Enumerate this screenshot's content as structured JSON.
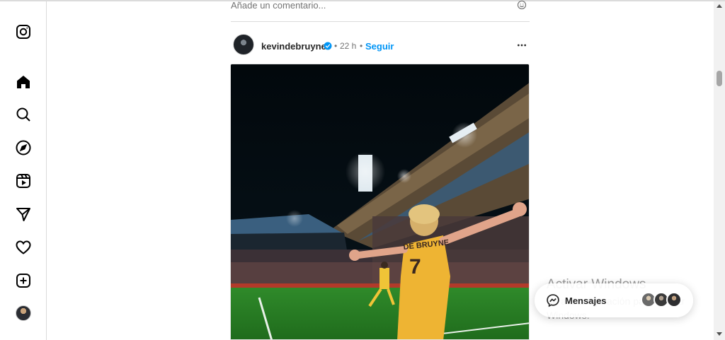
{
  "sidebar": {
    "icons": [
      "instagram-logo-icon",
      "home-icon",
      "search-icon",
      "explore-icon",
      "reels-icon",
      "messages-send-icon",
      "notifications-heart-icon",
      "create-plus-icon",
      "profile-avatar"
    ]
  },
  "comment": {
    "placeholder": "Añade un comentario..."
  },
  "post": {
    "username": "kevindebruyne",
    "time": "22 h",
    "separator": "•",
    "follow_label": "Seguir",
    "verified": true,
    "image_caption_text": "DE BRUYNE",
    "jersey_number": "7"
  },
  "watermark": {
    "title": "Activar Windows",
    "subtitle": "Ve a Configuración para activar Windows."
  },
  "messages_bar": {
    "label": "Mensajes"
  },
  "colors": {
    "accent": "#0095f6",
    "text": "#262626",
    "muted": "#737373",
    "border": "#dbdbdb"
  }
}
